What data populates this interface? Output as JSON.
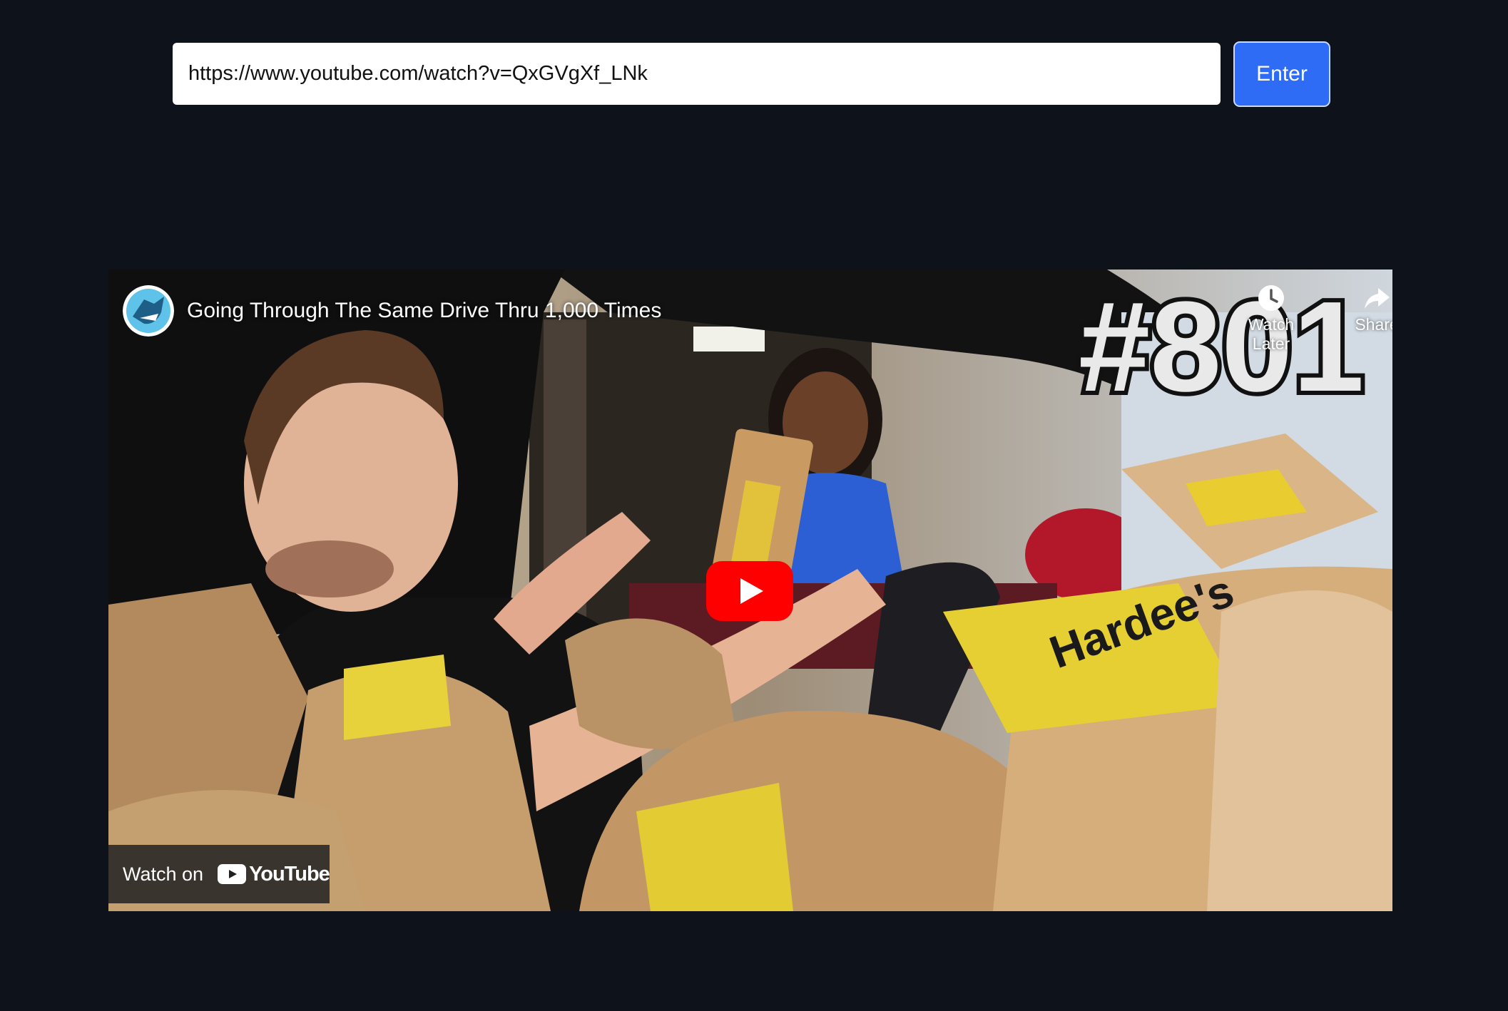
{
  "url_input": {
    "value": "https://www.youtube.com/watch?v=QxGVgXf_LNk"
  },
  "enter_button": {
    "label": "Enter"
  },
  "colors": {
    "page_background": "#0e121b",
    "button_blue": "#2f6cf6",
    "youtube_red": "#ff0000"
  },
  "player": {
    "video_title": "Going Through The Same Drive Thru 1,000 Times",
    "thumbnail_overlay_text": "#801",
    "bag_brand": "Hardee's",
    "watch_later_label": "Watch Later",
    "share_label": "Share",
    "watch_on_label": "Watch on",
    "youtube_logo_text": "YouTube",
    "icons": {
      "avatar": "channel-avatar-icon",
      "watch_later": "clock-icon",
      "share": "share-arrow-icon",
      "play": "play-icon",
      "youtube": "youtube-logo-icon"
    }
  }
}
